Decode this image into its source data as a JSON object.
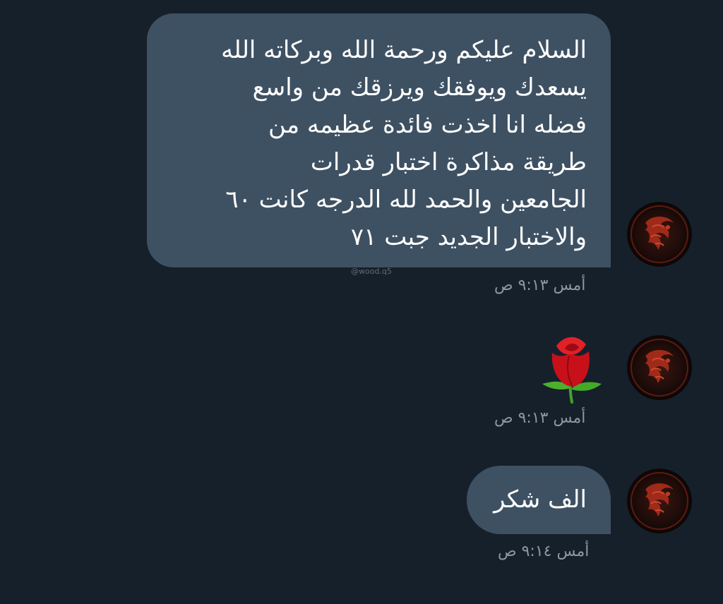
{
  "messages": [
    {
      "lines": [
        "السلام عليكم ورحمة الله وبركاته  الله",
        "يسعدك ويوفقك ويرزقك من واسع",
        "فضله انا اخذت فائدة عظيمه من",
        "طريقة مذاكرة اختبار قدرات",
        "الجامعين والحمد لله الدرجه كانت ٦٠",
        "والاختبار الجديد جبت ٧١"
      ],
      "timestamp": "أمس ٩:١٣ ص"
    },
    {
      "emoji": "rose-icon",
      "timestamp": "أمس ٩:١٣ ص"
    },
    {
      "text": "الف شكر",
      "timestamp": "أمس ٩:١٤ ص"
    }
  ],
  "watermark": "@wood.q5",
  "avatar": "dragon-sigil-icon",
  "colors": {
    "background": "#16202b",
    "bubble": "#3e5163",
    "timestamp": "#8b98a5",
    "avatar_red": "#a02a1a"
  }
}
